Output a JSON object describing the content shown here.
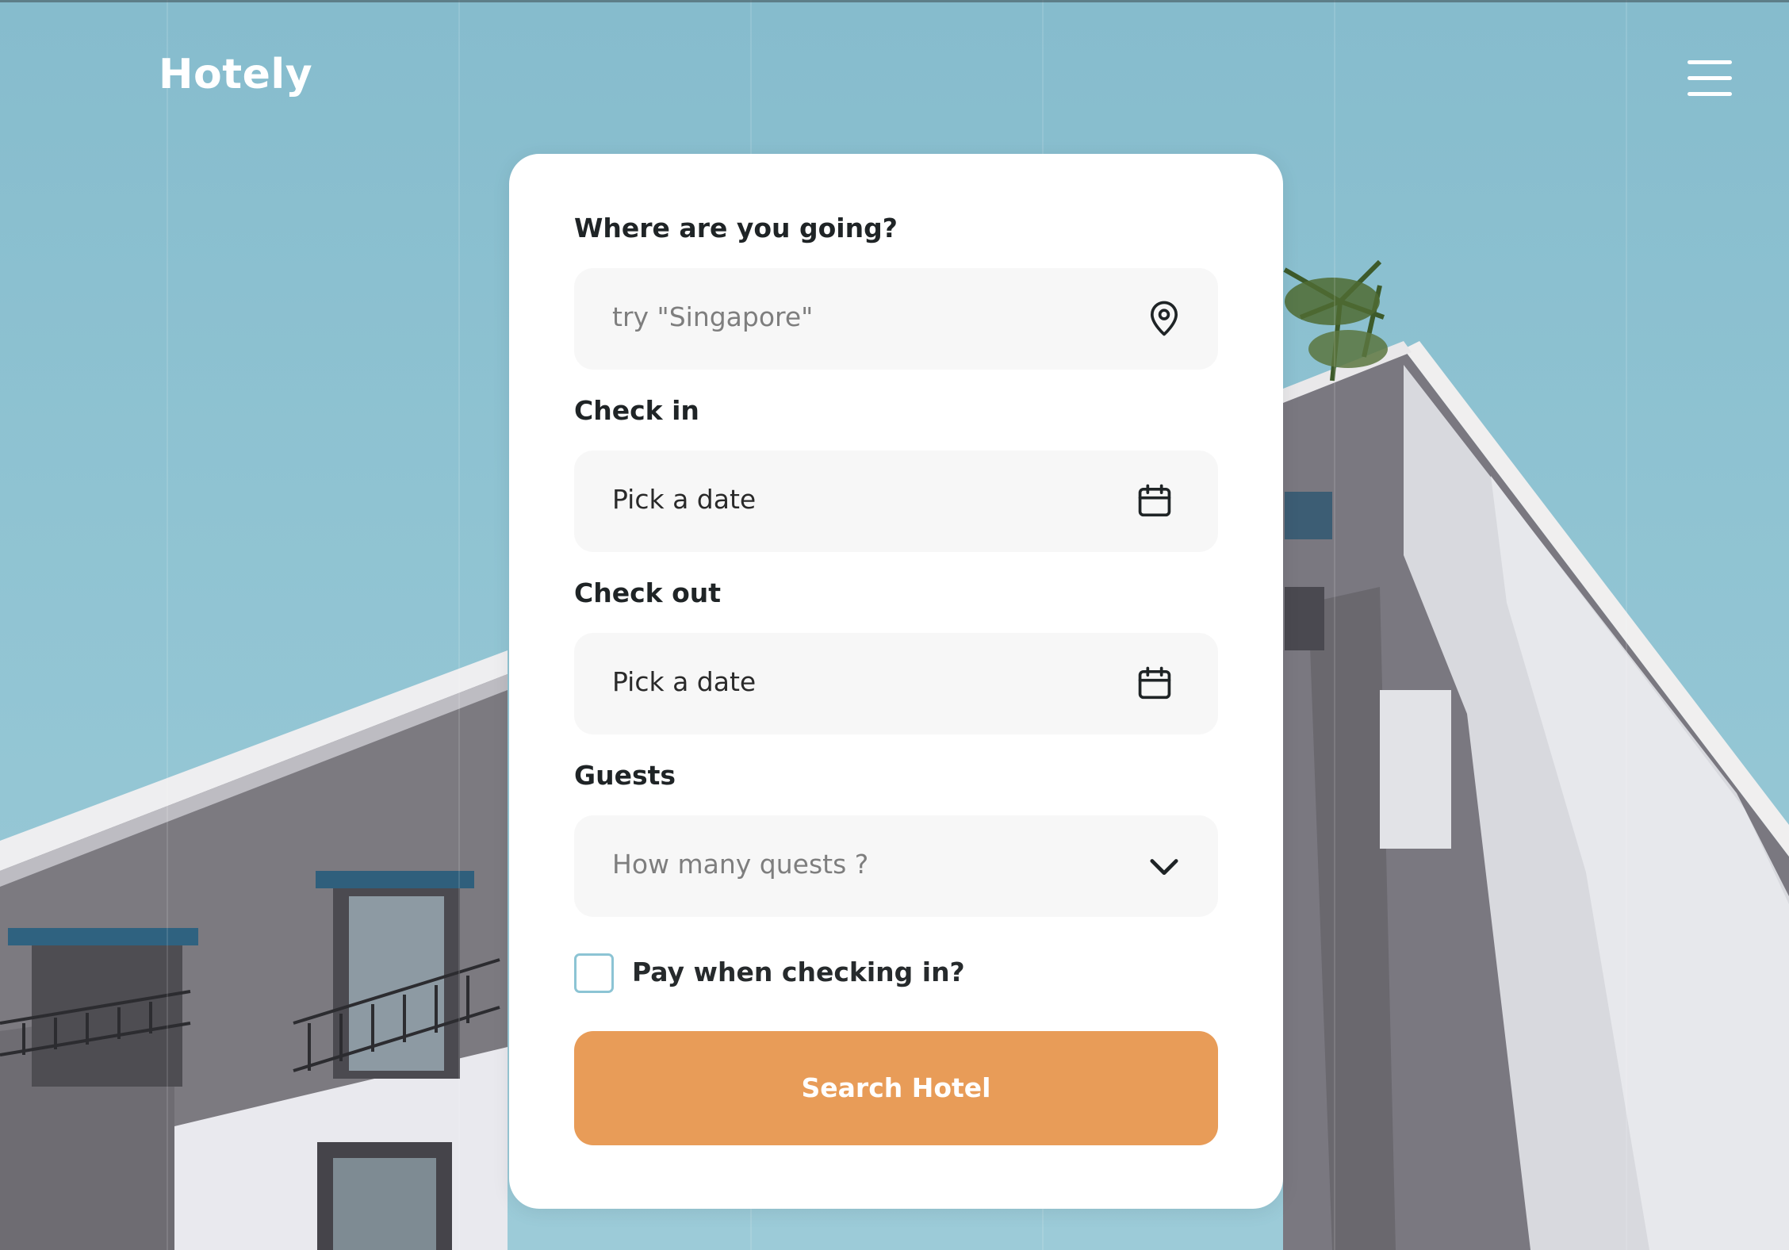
{
  "header": {
    "logo": "Hotely",
    "menu_icon": "hamburger-menu-icon"
  },
  "form": {
    "destination": {
      "label": "Where are you going?",
      "placeholder": "try \"Singapore\"",
      "icon": "map-pin-icon"
    },
    "check_in": {
      "label": "Check in",
      "value": "Pick a date",
      "icon": "calendar-icon"
    },
    "check_out": {
      "label": "Check out",
      "value": "Pick a date",
      "icon": "calendar-icon"
    },
    "guests": {
      "label": "Guests",
      "placeholder": "How many quests ?",
      "icon": "chevron-down-icon"
    },
    "pay_on_checkin": {
      "label": "Pay when checking in?",
      "checked": false
    },
    "submit_label": "Search Hotel"
  },
  "colors": {
    "accent": "#e89c58",
    "sky": "#8fc3d2",
    "field_bg": "#f7f7f7",
    "checkbox_border": "#8cc4d4"
  }
}
